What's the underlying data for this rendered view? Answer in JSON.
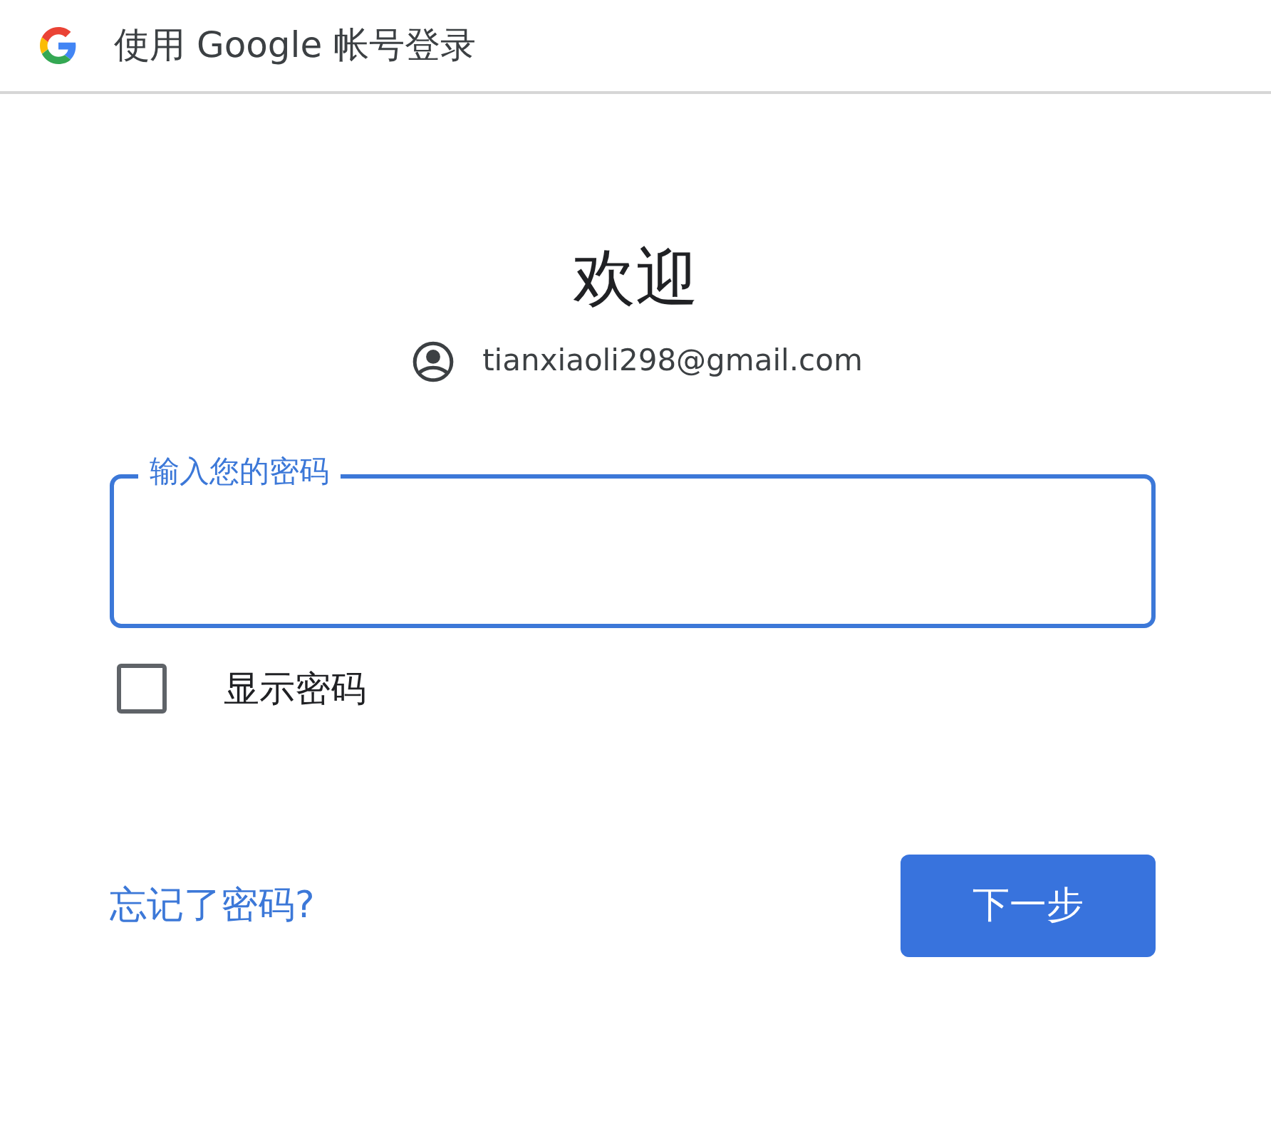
{
  "window": {
    "title": "使用 Google 帐号登录"
  },
  "heading": "欢迎",
  "account": {
    "email": "tianxiaoli298@gmail.com"
  },
  "password_field": {
    "label": "输入您的密码",
    "focused": true
  },
  "show_password": {
    "label": "显示密码",
    "checked": false
  },
  "forgot_link": "忘记了密码?",
  "next_button": "下一步"
}
